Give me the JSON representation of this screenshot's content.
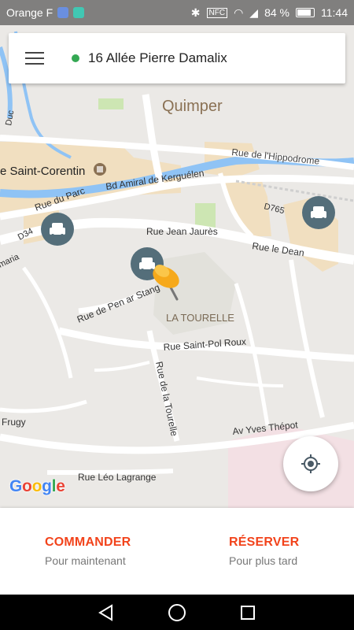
{
  "status_bar": {
    "carrier": "Orange F",
    "battery": "84 %",
    "time": "11:44"
  },
  "search_bar": {
    "address": "16 Allée Pierre Damalix",
    "status_color": "#34a853"
  },
  "map": {
    "labels": {
      "quimper": "Quimper",
      "hippodrome": "Rue de l'Hippodrome",
      "saint_corentin": "e Saint-Corentin",
      "bd_amiral": "Bd Amiral de Kerguélen",
      "rue_du_parc": "Rue du Parc",
      "d34": "D34",
      "d765": "D765",
      "jean_jaures": "Rue Jean Jaurès",
      "rue_le_dean": "Rue le Dean",
      "la_tourelle": "LA TOURELLE",
      "pen_ar_stang": "Rue de Pen ar Stang",
      "saint_pol_roux": "Rue Saint-Pol Roux",
      "rue_de_la_tourelle": "Rue de la Tourelle",
      "yves_thepot": "Av Yves Thépot",
      "leo_lagrange": "Rue Léo Lagrange",
      "frugy": "Frugy",
      "duc": "Duc",
      "maria": "maria"
    },
    "attribution": "Google"
  },
  "actions": {
    "commander": {
      "title": "COMMANDER",
      "subtitle": "Pour maintenant"
    },
    "reserver": {
      "title": "RÉSERVER",
      "subtitle": "Pour plus tard"
    }
  },
  "colors": {
    "accent": "#f2431b",
    "taxi_marker": "#546e7a",
    "river": "#8fc3f5"
  }
}
